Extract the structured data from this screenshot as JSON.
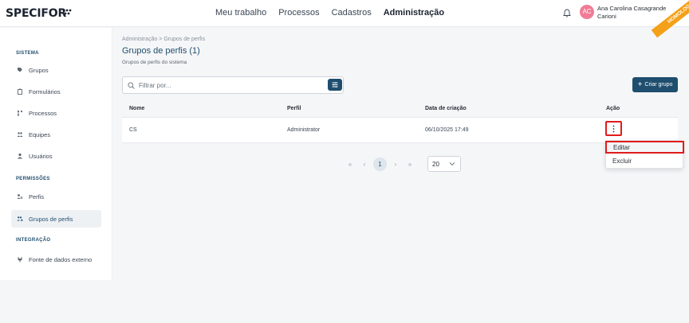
{
  "app": {
    "logo": "SPECIFOR",
    "environment_badge": "HOMOLOG",
    "nav": [
      "Meu trabalho",
      "Processos",
      "Cadastros",
      "Administração"
    ],
    "user": {
      "initials": "AC",
      "name": "Ana Carolina Casagrande Carioni"
    }
  },
  "sidebar": {
    "sections": [
      {
        "title": "SISTEMA",
        "items": [
          "Grupos",
          "Formulários",
          "Processos",
          "Equipes",
          "Usuários"
        ]
      },
      {
        "title": "PERMISSÕES",
        "items": [
          "Perfis",
          "Grupos de perfis"
        ]
      },
      {
        "title": "INTEGRAÇÃO",
        "items": [
          "Fonte de dados externo"
        ]
      }
    ],
    "active_item": "Grupos de perfis"
  },
  "main": {
    "breadcrumb": "Administração  >  Grupos de perfis",
    "title": "Grupos de perfis (1)",
    "subtitle": "Grupos de perfis do sistema",
    "filter_placeholder": "Filtrar por...",
    "create_button": "Criar grupo",
    "table": {
      "columns": [
        "Nome",
        "Perfil",
        "Data de criação",
        "Ação"
      ],
      "rows": [
        {
          "nome": "CS",
          "perfil": "Administrator",
          "data": "06/10/2025 17:49"
        }
      ]
    },
    "action_menu": {
      "edit": "Editar",
      "delete": "Excluir"
    },
    "pagination": {
      "first": "«",
      "prev": "‹",
      "current_page": "1",
      "next": "›",
      "last": "»",
      "page_size": "20"
    }
  },
  "colors": {
    "primary": "#1f4e6e",
    "highlight": "#e01b1b",
    "badge": "#f4a018",
    "avatar": "#f07c96"
  }
}
